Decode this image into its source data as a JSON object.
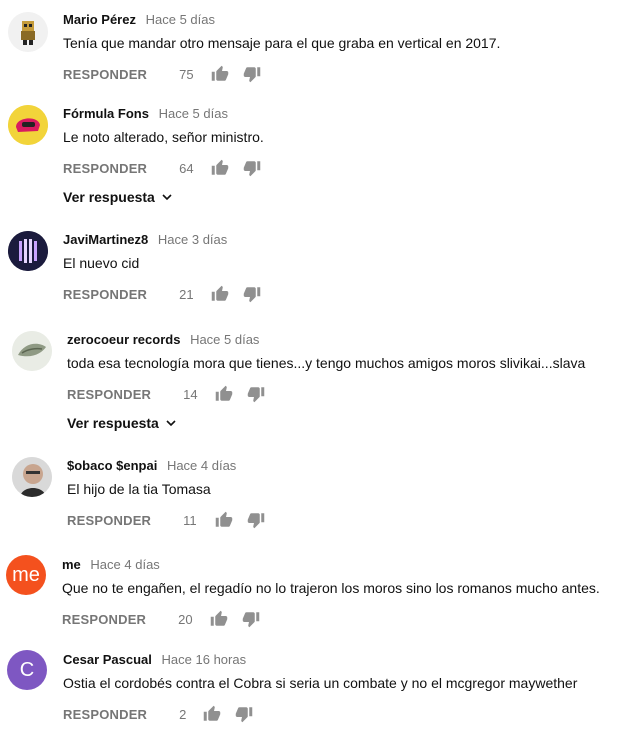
{
  "reply_label": "RESPONDER",
  "view_replies_label": "Ver respuesta",
  "comments": [
    {
      "author": "Mario Pérez",
      "time": "Hace 5 días",
      "text": "Tenía que mandar otro mensaje para el que graba en vertical en 2017.",
      "likes": "75"
    },
    {
      "author": "Fórmula Fons",
      "time": "Hace 5 días",
      "text": "Le noto alterado, señor ministro.",
      "likes": "64"
    },
    {
      "author": "JaviMartinez8",
      "time": "Hace 3 días",
      "text": "El nuevo cid",
      "likes": "21"
    },
    {
      "author": "zerocoeur records",
      "time": "Hace 5 días",
      "text": "toda esa tecnología mora que tienes...y tengo muchos amigos moros slivikai...slava",
      "likes": "14"
    },
    {
      "author": "$obaco $enpai",
      "time": "Hace 4 días",
      "text": "El hijo de la tia Tomasa",
      "likes": "11"
    },
    {
      "author": "me",
      "time": "Hace 4 días",
      "text": "Que no te engañen,  el regadío no lo trajeron los moros sino los romanos mucho antes.",
      "likes": "20",
      "avatar_letter": "me",
      "avatar_color": "#f4511e"
    },
    {
      "author": "Cesar Pascual",
      "time": "Hace 16 horas",
      "text": "Ostia el cordobés contra el Cobra  si seria un combate y no el mcgregor maywether",
      "likes": "2",
      "avatar_letter": "C",
      "avatar_color": "#7e57c2"
    }
  ]
}
